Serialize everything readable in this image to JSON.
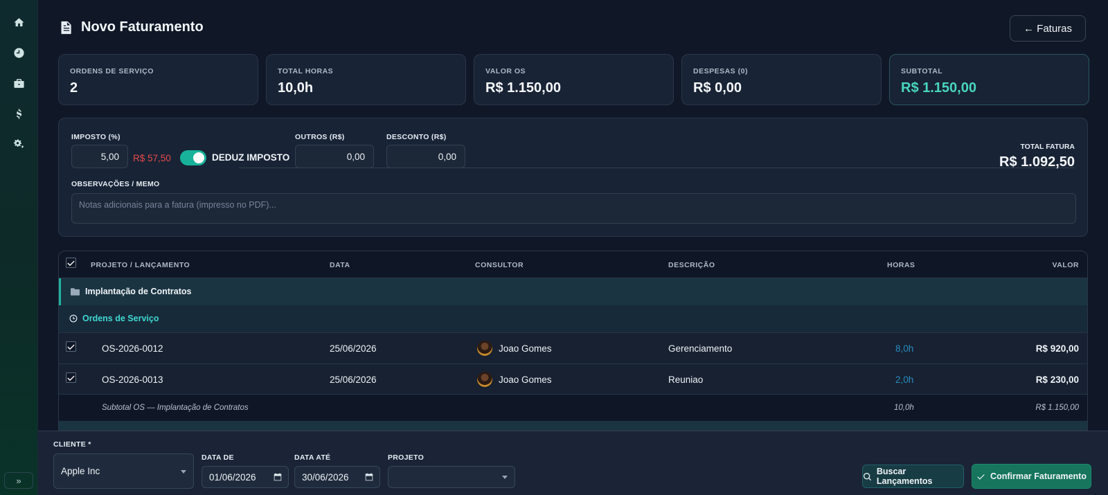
{
  "sidebar": {
    "items": [
      {
        "icon": "home-icon"
      },
      {
        "icon": "clock-icon"
      },
      {
        "icon": "briefcase-icon"
      },
      {
        "icon": "dollar-icon"
      },
      {
        "icon": "cogs-icon"
      }
    ],
    "expand_label": "»"
  },
  "header": {
    "title": "Novo Faturamento",
    "back_label": "← Faturas"
  },
  "summary": [
    {
      "label": "ORDENS DE SERVIÇO",
      "value": "2"
    },
    {
      "label": "TOTAL HORAS",
      "value": "10,0h"
    },
    {
      "label": "VALOR OS",
      "value": "R$ 1.150,00"
    },
    {
      "label": "DESPESAS (0)",
      "value": "R$ 0,00"
    },
    {
      "label": "SUBTOTAL",
      "value": "R$ 1.150,00"
    }
  ],
  "form": {
    "tax_label": "IMPOSTO (%)",
    "tax_value": "5,00",
    "tax_amount": "R$ 57,50",
    "deduct_label": "DEDUZ IMPOSTO",
    "deduct_on": true,
    "others_label": "OUTROS (R$)",
    "others_value": "0,00",
    "discount_label": "DESCONTO (R$)",
    "discount_value": "0,00",
    "total_label": "TOTAL FATURA",
    "total_value": "R$ 1.092,50",
    "memo_label": "OBSERVAÇÕES / MEMO",
    "memo_placeholder": "Notas adicionais para a fatura (impresso no PDF)..."
  },
  "table": {
    "headers": {
      "project": "PROJETO / LANÇAMENTO",
      "date": "DATA",
      "consultant": "CONSULTOR",
      "description": "DESCRIÇÃO",
      "hours": "HORAS",
      "value": "VALOR"
    },
    "group": "Implantação de Contratos",
    "subgroup": "Ordens de Serviço",
    "rows": [
      {
        "code": "OS-2026-0012",
        "date": "25/06/2026",
        "consultant": "Joao Gomes",
        "description": "Gerenciamento",
        "hours": "8,0h",
        "value": "R$ 920,00"
      },
      {
        "code": "OS-2026-0013",
        "date": "25/06/2026",
        "consultant": "Joao Gomes",
        "description": "Reuniao",
        "hours": "2,0h",
        "value": "R$ 230,00"
      }
    ],
    "subtotal": {
      "label": "Subtotal OS — Implantação de Contratos",
      "hours": "10,0h",
      "value": "R$ 1.150,00"
    }
  },
  "filters": {
    "client_label": "CLIENTE *",
    "client_value": "Apple Inc",
    "date_from_label": "DATA DE",
    "date_from_value": "01/06/2026",
    "date_to_label": "DATA ATÉ",
    "date_to_value": "30/06/2026",
    "project_label": "PROJETO",
    "project_value": "",
    "search_label": "Buscar Lançamentos",
    "confirm_label": "Confirmar Faturamento"
  },
  "colors": {
    "accent_teal": "#49d6c0",
    "danger": "#e84a4a",
    "confirm_green": "#16755c"
  }
}
